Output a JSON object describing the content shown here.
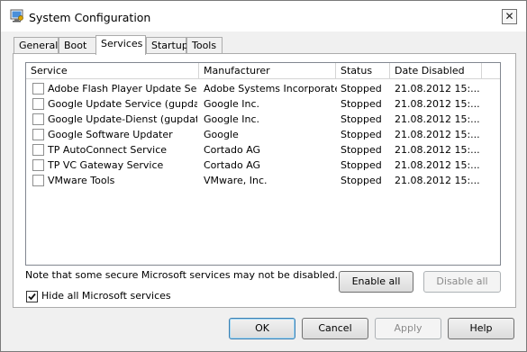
{
  "window": {
    "title": "System Configuration"
  },
  "tabs": [
    {
      "label": "General"
    },
    {
      "label": "Boot"
    },
    {
      "label": "Services",
      "active": true
    },
    {
      "label": "Startup"
    },
    {
      "label": "Tools"
    }
  ],
  "services_list": {
    "columns": [
      "Service",
      "Manufacturer",
      "Status",
      "Date Disabled"
    ],
    "rows": [
      {
        "checked": false,
        "service": "Adobe Flash Player Update Ser...",
        "manufacturer": "Adobe Systems Incorporated",
        "status": "Stopped",
        "date_disabled": "21.08.2012 15:..."
      },
      {
        "checked": false,
        "service": "Google Update Service (gupdate)",
        "manufacturer": "Google Inc.",
        "status": "Stopped",
        "date_disabled": "21.08.2012 15:..."
      },
      {
        "checked": false,
        "service": "Google Update-Dienst (gupdatem)",
        "manufacturer": "Google Inc.",
        "status": "Stopped",
        "date_disabled": "21.08.2012 15:..."
      },
      {
        "checked": false,
        "service": "Google Software Updater",
        "manufacturer": "Google",
        "status": "Stopped",
        "date_disabled": "21.08.2012 15:..."
      },
      {
        "checked": false,
        "service": "TP AutoConnect Service",
        "manufacturer": "Cortado AG",
        "status": "Stopped",
        "date_disabled": "21.08.2012 15:..."
      },
      {
        "checked": false,
        "service": "TP VC Gateway Service",
        "manufacturer": "Cortado AG",
        "status": "Stopped",
        "date_disabled": "21.08.2012 15:..."
      },
      {
        "checked": false,
        "service": "VMware Tools",
        "manufacturer": "VMware, Inc.",
        "status": "Stopped",
        "date_disabled": "21.08.2012 15:..."
      }
    ]
  },
  "note": "Note that some secure Microsoft services may not be disabled.",
  "enable_all": "Enable all",
  "disable_all": "Disable all",
  "hide_ms": {
    "label": "Hide all Microsoft services",
    "checked": true
  },
  "footer": {
    "ok": "OK",
    "cancel": "Cancel",
    "apply": "Apply",
    "help": "Help"
  }
}
